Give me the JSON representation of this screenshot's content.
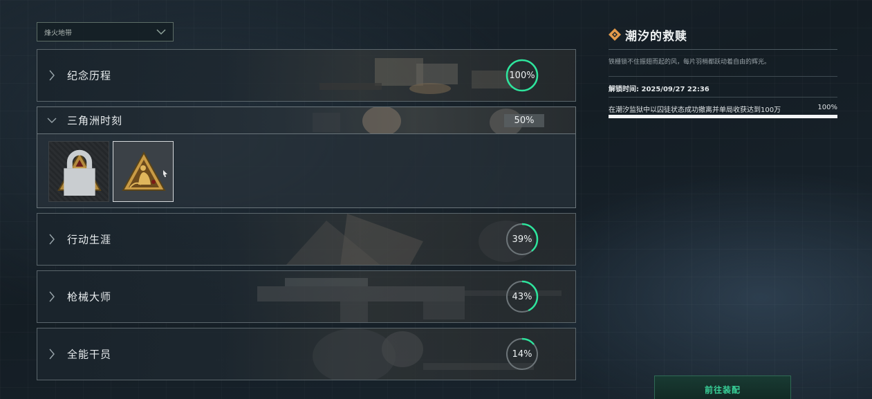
{
  "filter_dropdown": {
    "value": "烽火地带"
  },
  "categories": [
    {
      "title": "纪念历程",
      "percent": 100,
      "percent_label": "100%"
    },
    {
      "title": "三角洲时刻",
      "percent": 50,
      "percent_label": "50%"
    },
    {
      "title": "行动生涯",
      "percent": 39,
      "percent_label": "39%"
    },
    {
      "title": "枪械大师",
      "percent": 43,
      "percent_label": "43%"
    },
    {
      "title": "全能干员",
      "percent": 14,
      "percent_label": "14%"
    }
  ],
  "expanded_badges": [
    {
      "icon": "robot-triangle-badge-icon",
      "locked": true
    },
    {
      "icon": "figure-triangle-badge-icon",
      "locked": false,
      "selected": true
    }
  ],
  "detail": {
    "title": "潮汐的救赎",
    "description": "铁栅锁不住振翅而起的风，每片羽梢都跃动着自由的辉光。",
    "unlock_time": "解锁时间: 2025/09/27 22:36",
    "task": "在潮汐监狱中以囚徒状态成功撤离并单局收获达到100万",
    "task_percent_label": "100%",
    "task_progress": 1.0
  },
  "equip_button": {
    "label": "前往装配"
  },
  "colors": {
    "accent_green": "#39d39a",
    "ring_green": "#2ee59d",
    "ring_track": "#6c7478",
    "orange_icon": "#e39a4b"
  }
}
